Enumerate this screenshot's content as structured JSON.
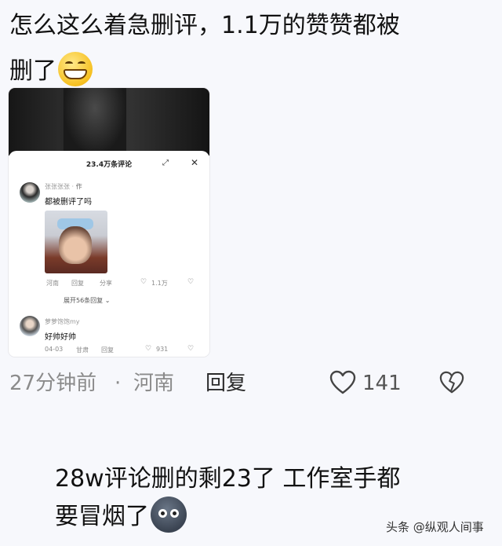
{
  "comment": {
    "text_line1": "怎么这么着急删评，1.1万的赞赞都被",
    "text_line2": "删了",
    "emoji": "grinning-face-icon"
  },
  "embedded_screenshot": {
    "popup_title": "23.4万条评论",
    "comments": [
      {
        "username": "张张张张 ·",
        "author_tag": "作",
        "text": "都被删评了吗",
        "location": "河南",
        "reply_label": "回复",
        "share_label": "分享",
        "likes": "1.1万"
      },
      {
        "username": "萝萝饱饱my",
        "text": "好帅好帅",
        "date": "04-03",
        "location": "甘肃",
        "reply_label": "回复",
        "likes": "931"
      }
    ],
    "expand_replies": "展开56条回复 ⌄"
  },
  "meta": {
    "time": "27分钟前",
    "separator": "·",
    "location": "河南",
    "reply_label": "回复",
    "like_count": "141"
  },
  "caption": {
    "line1": "28w评论删的剩23了 工作室手都",
    "line2": "要冒烟了",
    "emoji": "mask-face-icon"
  },
  "watermark": "头条 @纵观人间事"
}
